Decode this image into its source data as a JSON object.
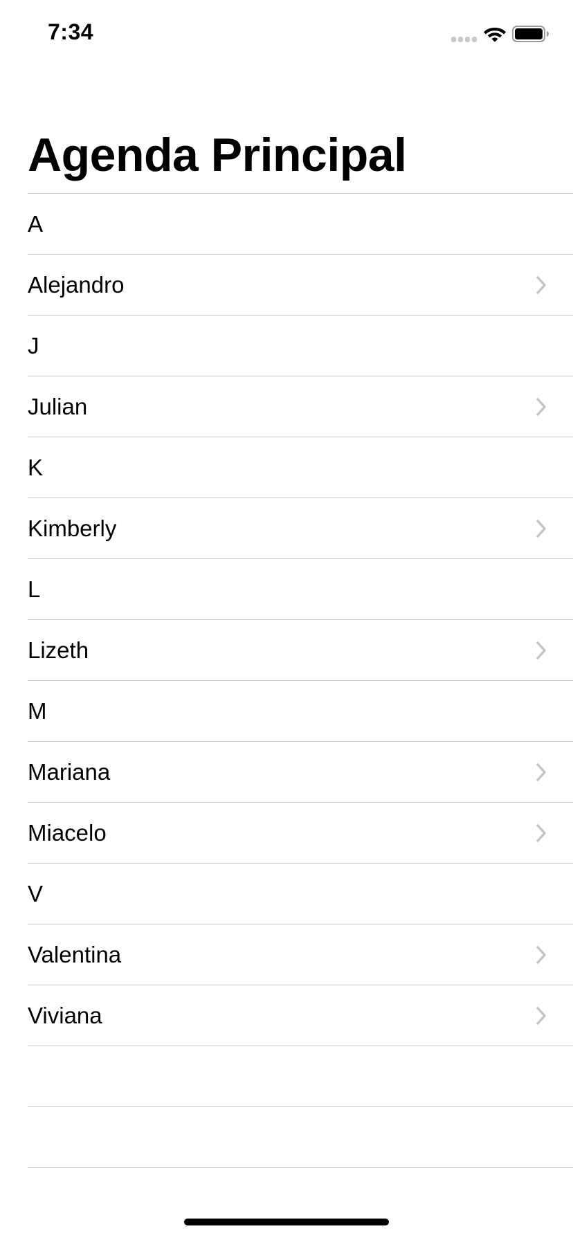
{
  "status_bar": {
    "time": "7:34",
    "icons": [
      "signal-icon",
      "wifi-icon",
      "battery-icon"
    ]
  },
  "navigation": {
    "title": "Agenda Principal"
  },
  "list": {
    "rows": [
      {
        "label": "A",
        "type": "section-header"
      },
      {
        "label": "Alejandro",
        "type": "contact",
        "accessory": "chevron-right-icon"
      },
      {
        "label": "J",
        "type": "section-header"
      },
      {
        "label": "Julian",
        "type": "contact",
        "accessory": "chevron-right-icon"
      },
      {
        "label": "K",
        "type": "section-header"
      },
      {
        "label": "Kimberly",
        "type": "contact",
        "accessory": "chevron-right-icon"
      },
      {
        "label": "L",
        "type": "section-header"
      },
      {
        "label": "Lizeth",
        "type": "contact",
        "accessory": "chevron-right-icon"
      },
      {
        "label": "M",
        "type": "section-header"
      },
      {
        "label": "Mariana",
        "type": "contact",
        "accessory": "chevron-right-icon"
      },
      {
        "label": "Miacelo",
        "type": "contact",
        "accessory": "chevron-right-icon"
      },
      {
        "label": "V",
        "type": "section-header"
      },
      {
        "label": "Valentina",
        "type": "contact",
        "accessory": "chevron-right-icon"
      },
      {
        "label": "Viviana",
        "type": "contact",
        "accessory": "chevron-right-icon"
      }
    ]
  },
  "colors": {
    "separator": "#c8c7cc",
    "chevron": "#c4c4c7",
    "text": "#000000",
    "background": "#ffffff"
  }
}
